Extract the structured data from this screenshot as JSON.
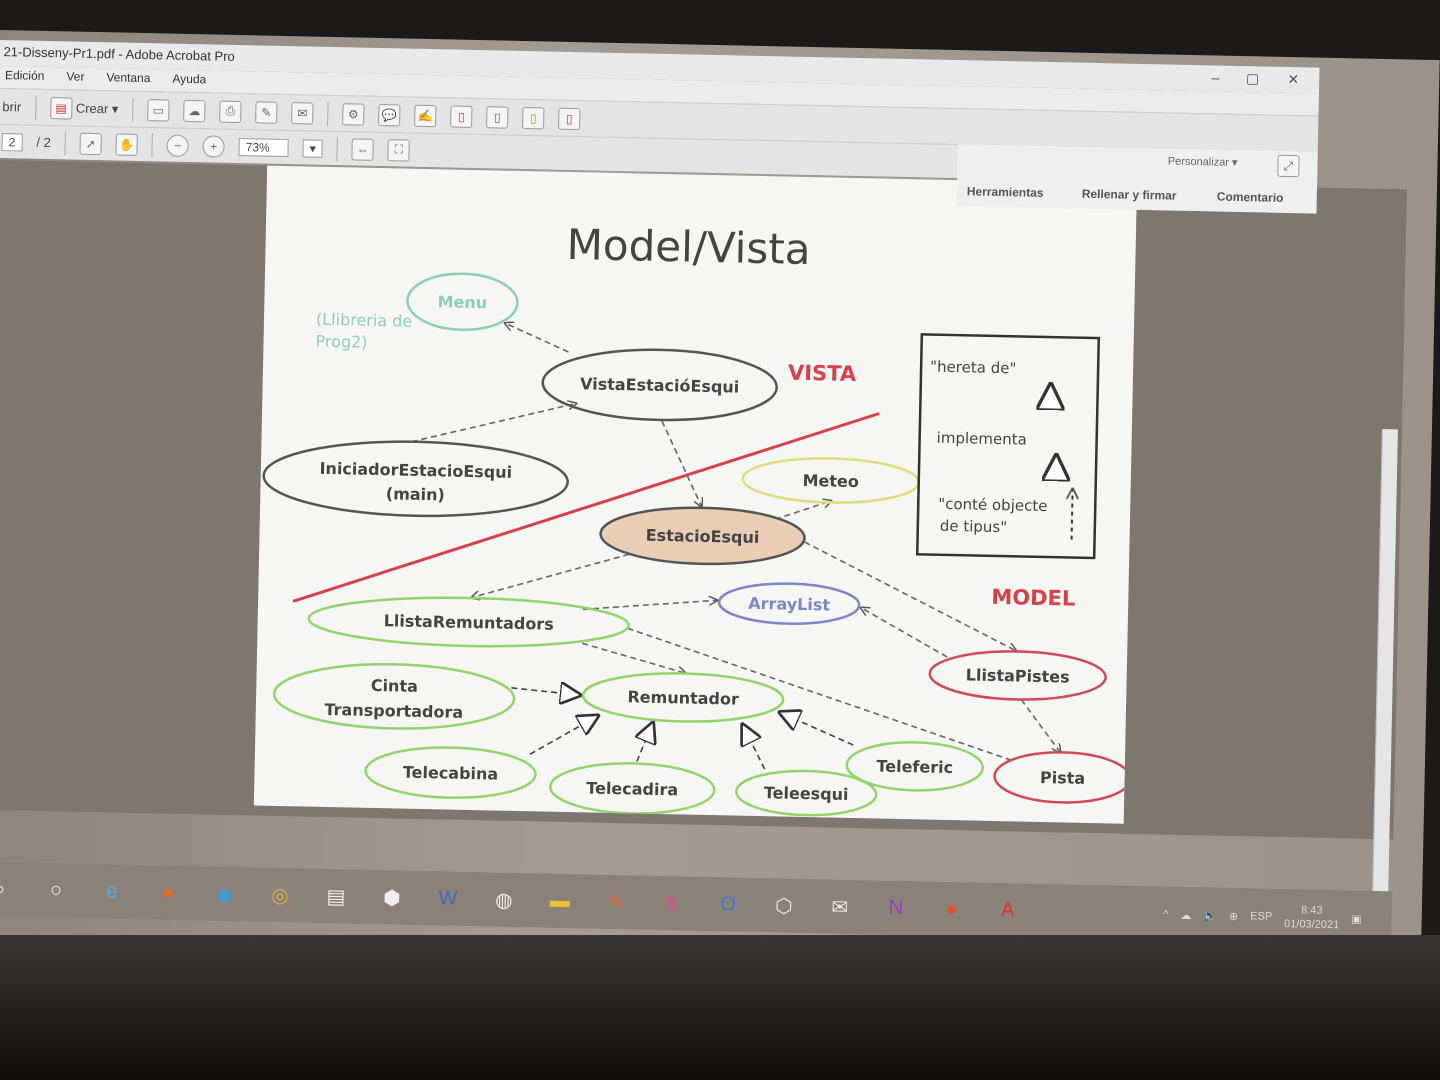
{
  "window": {
    "title": "21-Disseny-Pr1.pdf - Adobe Acrobat Pro",
    "minimize": "–",
    "maximize": "▢",
    "close": "✕"
  },
  "menu": [
    "Edición",
    "Ver",
    "Ventana",
    "Ayuda"
  ],
  "toolbar": {
    "open": "brir",
    "create": "Crear ▾",
    "page_current": "2",
    "page_total": "/ 2",
    "zoom": "73%",
    "zoom_caret": "▾"
  },
  "rightpanel": {
    "customize": "Personalizar ▾",
    "tabs": [
      "Herramientas",
      "Rellenar y firmar",
      "Comentario"
    ]
  },
  "slide": {
    "title": "Model/Vista",
    "library_note_1": "(Llibreria de",
    "library_note_2": "Prog2)",
    "vista_label": "VISTA",
    "model_label": "MODEL",
    "legend": {
      "inherits": "\"hereta de\"",
      "implements": "implementa",
      "contains_1": "\"conté objecte",
      "contains_2": "de tipus\""
    },
    "nodes": {
      "menu": "Menu",
      "vista": "VistaEstacióEsqui",
      "iniciador_1": "IniciadorEstacioEsqui",
      "iniciador_2": "(main)",
      "meteo": "Meteo",
      "estacio": "EstacioEsqui",
      "arraylist": "ArrayList",
      "llista_remuntadors": "LlistaRemuntadors",
      "llista_pistes": "LlistaPistes",
      "cinta_1": "Cinta",
      "cinta_2": "Transportadora",
      "remuntador": "Remuntador",
      "telecabina": "Telecabina",
      "telecadira": "Telecadira",
      "teleesqui": "Teleesqui",
      "teleferic": "Teleferic",
      "pista": "Pista"
    },
    "colors": {
      "vista_red": "#d9414a",
      "green": "#8fd66a",
      "red": "#d04a55",
      "blue": "#7d86c9",
      "yellow": "#e0de7a",
      "teal": "#8ccfb8",
      "estacio_fill": "#e9cdb4"
    }
  },
  "taskbar": {
    "icons": [
      "search-icon",
      "cortana-icon",
      "edge-legacy-icon",
      "firefox-icon",
      "edge-icon",
      "chrome-icon",
      "notepad-icon",
      "3d-icon",
      "word-icon",
      "edge-beta-icon",
      "explorer-icon",
      "paint-icon",
      "tool-icon",
      "outlook-icon",
      "box-icon",
      "mail-icon",
      "onenote-icon",
      "record-icon",
      "acrobat-icon"
    ],
    "lang": "ESP",
    "time": "8:43",
    "date": "01/03/2021"
  }
}
